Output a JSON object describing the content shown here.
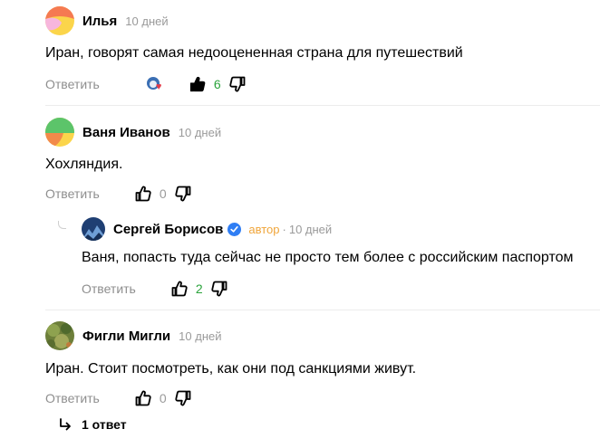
{
  "comments": [
    {
      "author": "Илья",
      "time": "10 дней",
      "text": "Иран, говорят самая недооцененная страна для путешествий",
      "reply_label": "Ответить",
      "likes": "6"
    },
    {
      "author": "Ваня Иванов",
      "time": "10 дней",
      "text": "Хохляндия.",
      "reply_label": "Ответить",
      "likes": "0"
    },
    {
      "author": "Сергей Борисов",
      "author_tag": "автор",
      "time_sep": "·",
      "time": "10 дней",
      "text": "Ваня, попасть туда сейчас не просто тем более с российским паспортом",
      "reply_label": "Ответить",
      "likes": "2"
    },
    {
      "author": "Фигли Мигли",
      "time": "10 дней",
      "text": "Иран. Стоит посмотреть, как они под санкциями живут.",
      "reply_label": "Ответить",
      "likes": "0"
    }
  ],
  "replies_toggle": {
    "label": "1 ответ"
  },
  "icons": {
    "like": "thumbs-up-icon",
    "dislike": "thumbs-down-icon",
    "reply_arrow": "reply-arrow-icon",
    "verified": "verified-check-icon"
  },
  "colors": {
    "likes_positive": "#2aa33b",
    "author_tag": "#f0a53a",
    "verified": "#2f7ef4"
  }
}
